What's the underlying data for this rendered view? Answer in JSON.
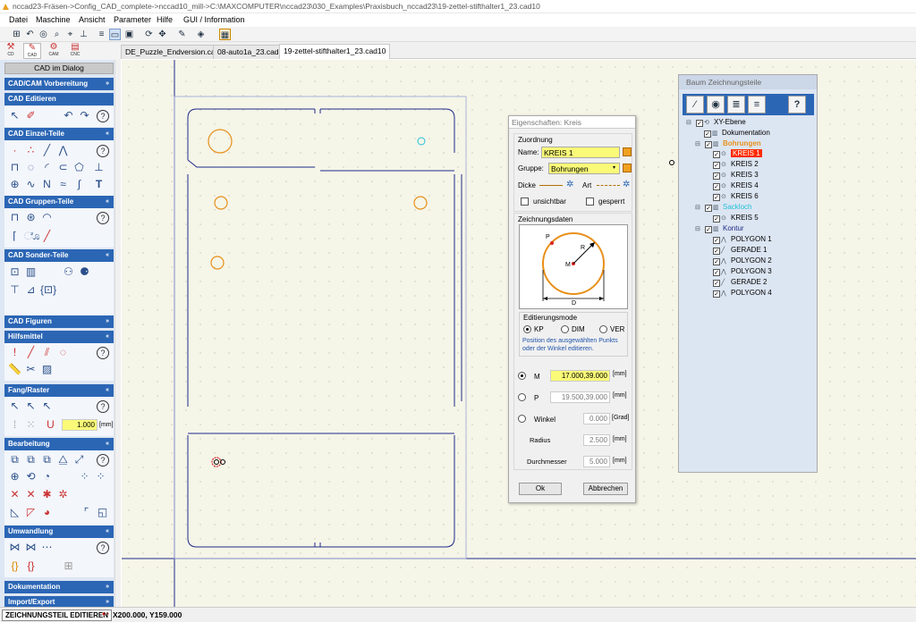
{
  "window": {
    "title": "nccad23-Fräsen->Config_CAD_complete->nccad10_mill->C:\\MAXCOMPUTER\\nccad23\\030_Examples\\Praxisbuch_nccad23\\19-zettel-stifthalter1_23.cad10"
  },
  "menu": [
    "Datei",
    "Maschine",
    "Ansicht",
    "Parameter",
    "Hilfe",
    "GUI / Information"
  ],
  "modes": [
    "CD",
    "CAD",
    "CAM",
    "CNC"
  ],
  "tabs": [
    "DE_Puzzle_Endversion.cad10",
    "08-auto1a_23.cad10",
    "19-zettel-stifthalter1_23.cad10"
  ],
  "panel": {
    "title": "CAD im Dialog",
    "sections": {
      "camvor": "CAD/CAM Vorbereitung",
      "edit": "CAD Editieren",
      "einzel": "CAD Einzel-Teile",
      "gruppen": "CAD Gruppen-Teile",
      "sonder": "CAD Sonder-Teile",
      "figuren": "CAD Figuren",
      "hilf": "Hilfsmittel",
      "fang": "Fang/Raster",
      "bearb": "Bearbeitung",
      "umw": "Umwandlung",
      "doku": "Dokumentation",
      "import": "Import/Export"
    },
    "fang_value": "1.000",
    "fang_unit": "[mm]"
  },
  "dialog": {
    "title": "Eigenschaften: Kreis",
    "zuordnung": "Zuordnung",
    "name_label": "Name:",
    "name_value": "KREIS 1",
    "gruppe_label": "Gruppe:",
    "gruppe_value": "Bohrungen",
    "dicke": "Dicke",
    "art": "Art",
    "unsichtbar": "unsichtbar",
    "gesperrt": "gesperrt",
    "zeichnungsdaten": "Zeichnungsdaten",
    "diagram": {
      "p": "P",
      "r": "R",
      "m": "M",
      "d": "D"
    },
    "editmode_label": "Editierungsmode",
    "modes": [
      "KP",
      "DIM",
      "VER"
    ],
    "hint": "Position des ausgewählten Punkts oder der Winkel editieren.",
    "m_label": "M",
    "m_value": "17.000,39.000",
    "m_unit": "[mm]",
    "p_label": "P",
    "p_value": "19.500,39.000",
    "p_unit": "[mm]",
    "winkel_label": "Winkel",
    "winkel_value": "0.000",
    "winkel_unit": "[Grad]",
    "radius_label": "Radius",
    "radius_value": "2.500",
    "radius_unit": "[mm]",
    "durch_label": "Durchmesser",
    "durch_value": "5.000",
    "durch_unit": "[mm]",
    "ok": "Ok",
    "cancel": "Abbrechen"
  },
  "tree": {
    "title": "Baum Zeichnungsteile",
    "root": "XY-Ebene",
    "doku": "Dokumentation",
    "bohrungen": "Bohrungen",
    "kreis1": "KREIS 1",
    "kreis2": "KREIS 2",
    "kreis3": "KREIS 3",
    "kreis4": "KREIS 4",
    "kreis6": "KREIS 6",
    "sackloch": "Sackloch",
    "kreis5": "KREIS 5",
    "kontur": "Kontur",
    "poly1": "POLYGON 1",
    "ger1": "GERADE 1",
    "poly2": "POLYGON 2",
    "poly3": "POLYGON 3",
    "ger2": "GERADE 2",
    "poly4": "POLYGON 4",
    "help": "?"
  },
  "status": {
    "mode": "ZEICHNUNGSTEIL EDITIEREN",
    "coord": "X200.000, Y159.000"
  },
  "colors": {
    "accent": "#2b66b5",
    "orange": "#e8901a",
    "highlight": "#ff2a00",
    "cyan": "#22c0d8"
  }
}
